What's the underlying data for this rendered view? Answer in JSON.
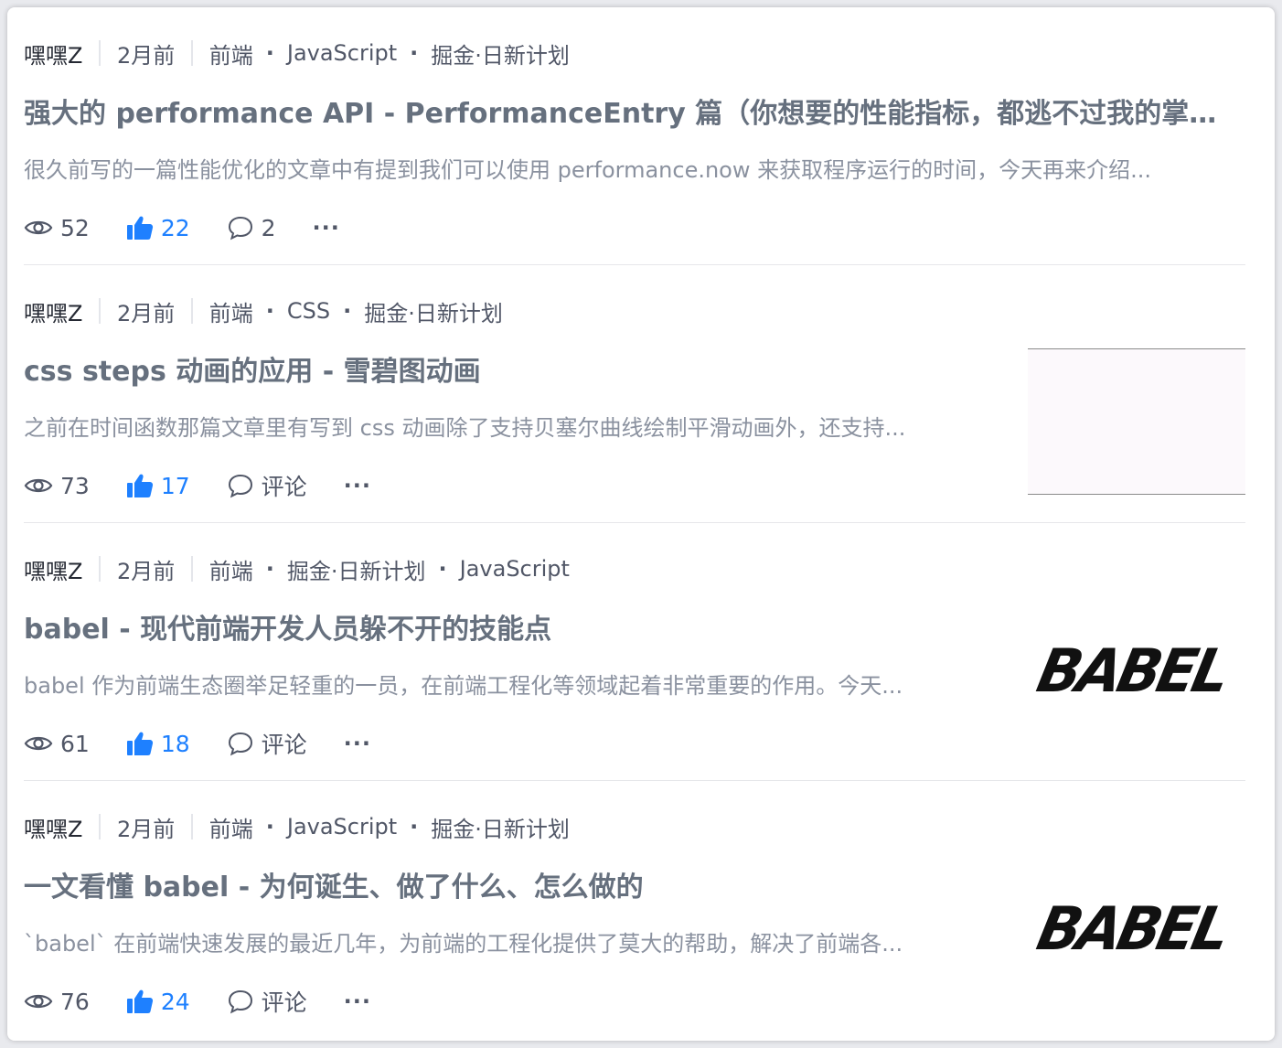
{
  "articles": [
    {
      "author": "嘿嘿Z",
      "time": "2月前",
      "tags": [
        "前端",
        "JavaScript",
        "掘金·日新计划"
      ],
      "title": "强大的 performance API - PerformanceEntry 篇（你想要的性能指标，都逃不过我的掌控...",
      "summary": "很久前写的一篇性能优化的文章中有提到我们可以使用 performance.now 来获取程序运行的时间，今天再来介绍...",
      "views": "52",
      "likes": "22",
      "comments": "2",
      "more": "···",
      "thumbnail": null
    },
    {
      "author": "嘿嘿Z",
      "time": "2月前",
      "tags": [
        "前端",
        "CSS",
        "掘金·日新计划"
      ],
      "title": "css steps 动画的应用 - 雪碧图动画",
      "summary": "之前在时间函数那篇文章里有写到 css 动画除了支持贝塞尔曲线绘制平滑动画外，还支持...",
      "views": "73",
      "likes": "17",
      "comments": "评论",
      "more": "···",
      "thumbnail": "blank"
    },
    {
      "author": "嘿嘿Z",
      "time": "2月前",
      "tags": [
        "前端",
        "掘金·日新计划",
        "JavaScript"
      ],
      "title": "babel - 现代前端开发人员躲不开的技能点",
      "summary": "babel 作为前端生态圈举足轻重的一员，在前端工程化等领域起着非常重要的作用。今天...",
      "views": "61",
      "likes": "18",
      "comments": "评论",
      "more": "···",
      "thumbnail": "babel-logo"
    },
    {
      "author": "嘿嘿Z",
      "time": "2月前",
      "tags": [
        "前端",
        "JavaScript",
        "掘金·日新计划"
      ],
      "title": "一文看懂 babel - 为何诞生、做了什么、怎么做的",
      "summary": "`babel` 在前端快速发展的最近几年，为前端的工程化提供了莫大的帮助，解决了前端各...",
      "views": "76",
      "likes": "24",
      "comments": "评论",
      "more": "···",
      "thumbnail": "babel-logo"
    }
  ],
  "babel_logo_text": "BABEL",
  "colors": {
    "like_active": "#1e80ff",
    "title": "#66707e",
    "summary": "#8a919f",
    "meta": "#515767",
    "divider": "#e6e7ea"
  },
  "icons": {
    "views": "eye-icon",
    "likes": "thumbs-up-icon",
    "comments": "comment-bubble-icon",
    "more": "ellipsis-icon"
  }
}
